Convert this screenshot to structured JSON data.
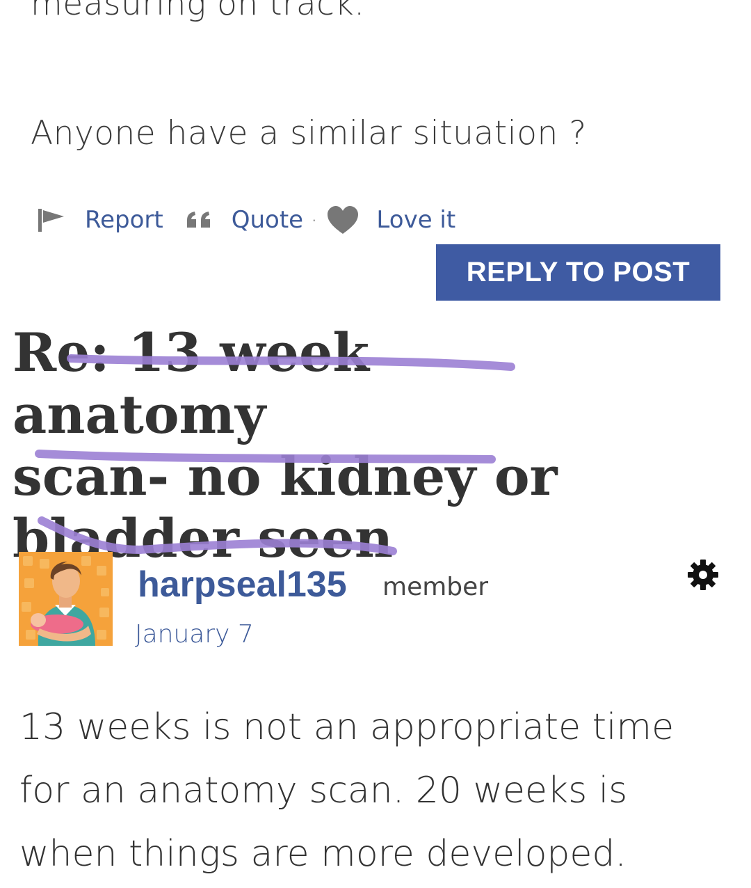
{
  "previous_post": {
    "line1": "measuring on track.",
    "line2": "Anyone have a similar situation ?"
  },
  "actions": {
    "report": "Report",
    "quote": "Quote",
    "separator": "·",
    "love": "Love it"
  },
  "reply_button": "REPLY TO POST",
  "post": {
    "title_lines": [
      "Re: 13 week anatomy",
      "scan- no kidney or",
      "bladder seen"
    ],
    "author": "harpseal135",
    "role": "member",
    "date": "January 7",
    "body_lines": [
      "13 weeks is not an appropriate time",
      "for an anatomy scan.  20 weeks is",
      "when things are more developed."
    ]
  },
  "icons": {
    "report": "flag-icon",
    "quote": "quote-icon",
    "love": "heart-icon",
    "settings": "gear-icon"
  },
  "colors": {
    "link": "#3d5a99",
    "button": "#3f5ba3",
    "scribble": "#9b7fd4",
    "text": "#333333"
  }
}
